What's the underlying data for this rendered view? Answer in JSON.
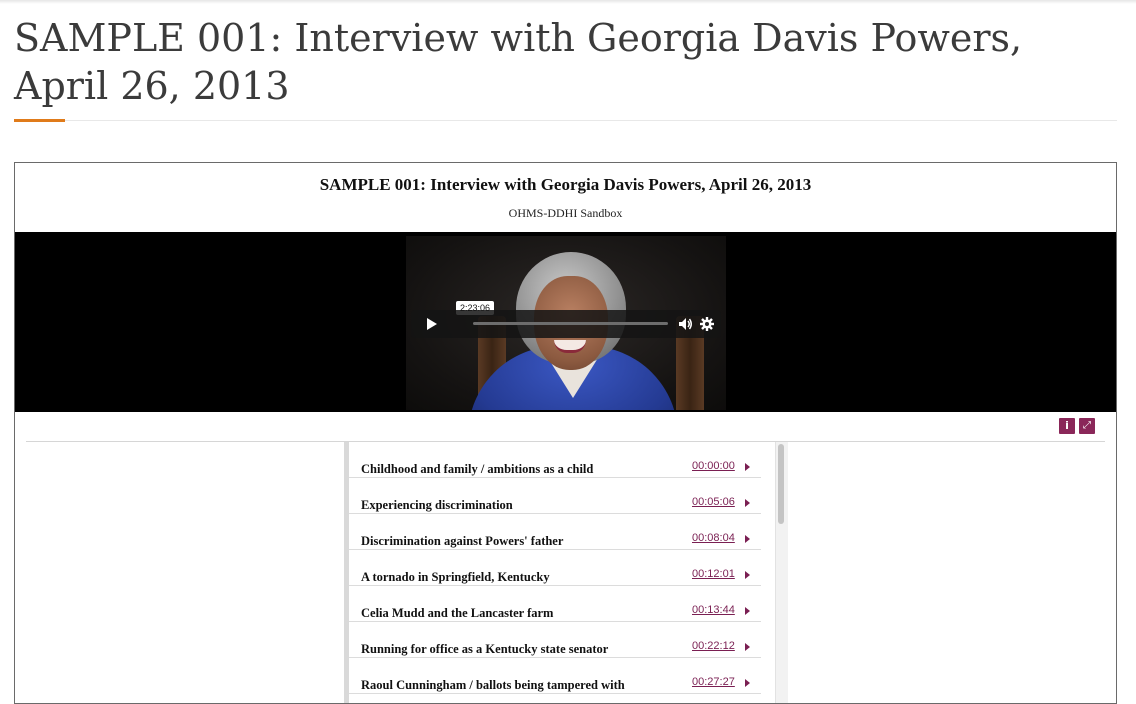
{
  "page": {
    "title": "SAMPLE 001: Interview with Georgia Davis Powers, April 26, 2013"
  },
  "viewer": {
    "title": "SAMPLE 001: Interview with Georgia Davis Powers, April 26, 2013",
    "repository": "OHMS-DDHI Sandbox"
  },
  "player": {
    "time_tooltip": "2:23:06",
    "play_icon": "play-icon",
    "volume_icon": "volume-icon",
    "settings_icon": "gear-icon"
  },
  "toolbar": {
    "info_icon": "info-icon",
    "info_glyph": "i",
    "expand_icon": "expand-icon",
    "expand_glyph": "⤢"
  },
  "index": {
    "segments": [
      {
        "title": "Childhood and family / ambitions as a child",
        "time": "00:00:00"
      },
      {
        "title": "Experiencing discrimination",
        "time": "00:05:06"
      },
      {
        "title": "Discrimination against Powers' father",
        "time": "00:08:04"
      },
      {
        "title": "A tornado in Springfield, Kentucky",
        "time": "00:12:01"
      },
      {
        "title": "Celia Mudd and the Lancaster farm",
        "time": "00:13:44"
      },
      {
        "title": "Running for office as a Kentucky state senator",
        "time": "00:22:12"
      },
      {
        "title": "Raoul Cunningham / ballots being tampered with",
        "time": "00:27:27"
      }
    ]
  },
  "colors": {
    "accent": "#e07b1a",
    "brand": "#8a2759",
    "link": "#7a1f52"
  }
}
